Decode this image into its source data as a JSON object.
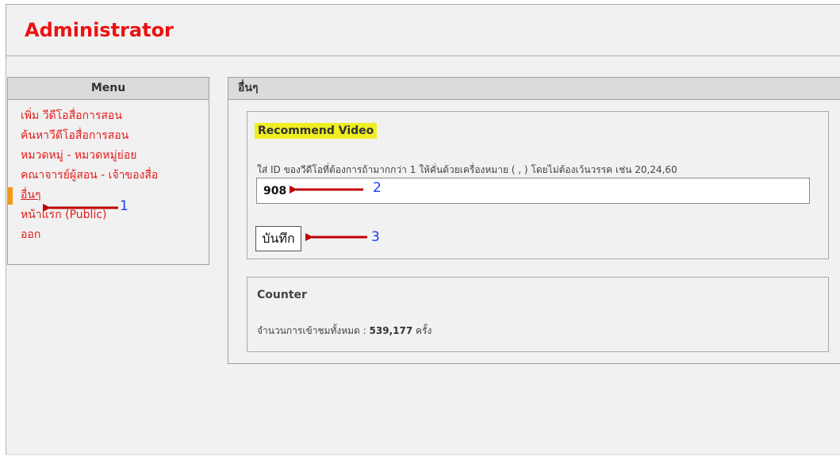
{
  "header": {
    "title": "Administrator"
  },
  "sidebar": {
    "title": "Menu",
    "items": [
      {
        "label": "เพิ่ม วีดีโอสื่อการสอน"
      },
      {
        "label": "ค้นหาวีดีโอสื่อการสอน"
      },
      {
        "label": "หมวดหมู่ - หมวดหมู่ย่อย"
      },
      {
        "label": "คณาจารย์ผู้สอน - เจ้าของสื่อ"
      },
      {
        "label": "อื่นๆ",
        "active": true
      },
      {
        "label": "หน้าแรก (Public)"
      },
      {
        "label": "ออก"
      }
    ]
  },
  "main": {
    "title": "อื่นๆ",
    "recommend": {
      "title": "Recommend Video",
      "instruction": "ใส่ ID ของวีดีโอที่ต้องการถ้ามากกว่า 1 ให้คั่นด้วยเครื่องหมาย ( , ) โดยไม่ต้องเว้นวรรค เช่น 20,24,60",
      "input_value": "908",
      "save_label": "บันทึก"
    },
    "counter": {
      "title": "Counter",
      "label": "จำนวนการเข้าชมทั้งหมด :",
      "value": "539,177",
      "unit": "ครั้ง"
    }
  },
  "annotations": {
    "one": "1",
    "two": "2",
    "three": "3",
    "arrow_color": "#c00000",
    "number_color": "#1b3cf0"
  },
  "colors": {
    "title_red": "#ee1111",
    "link_red": "#e41b1b",
    "active_indicator": "#f39a16",
    "highlight": "#eeee22"
  }
}
